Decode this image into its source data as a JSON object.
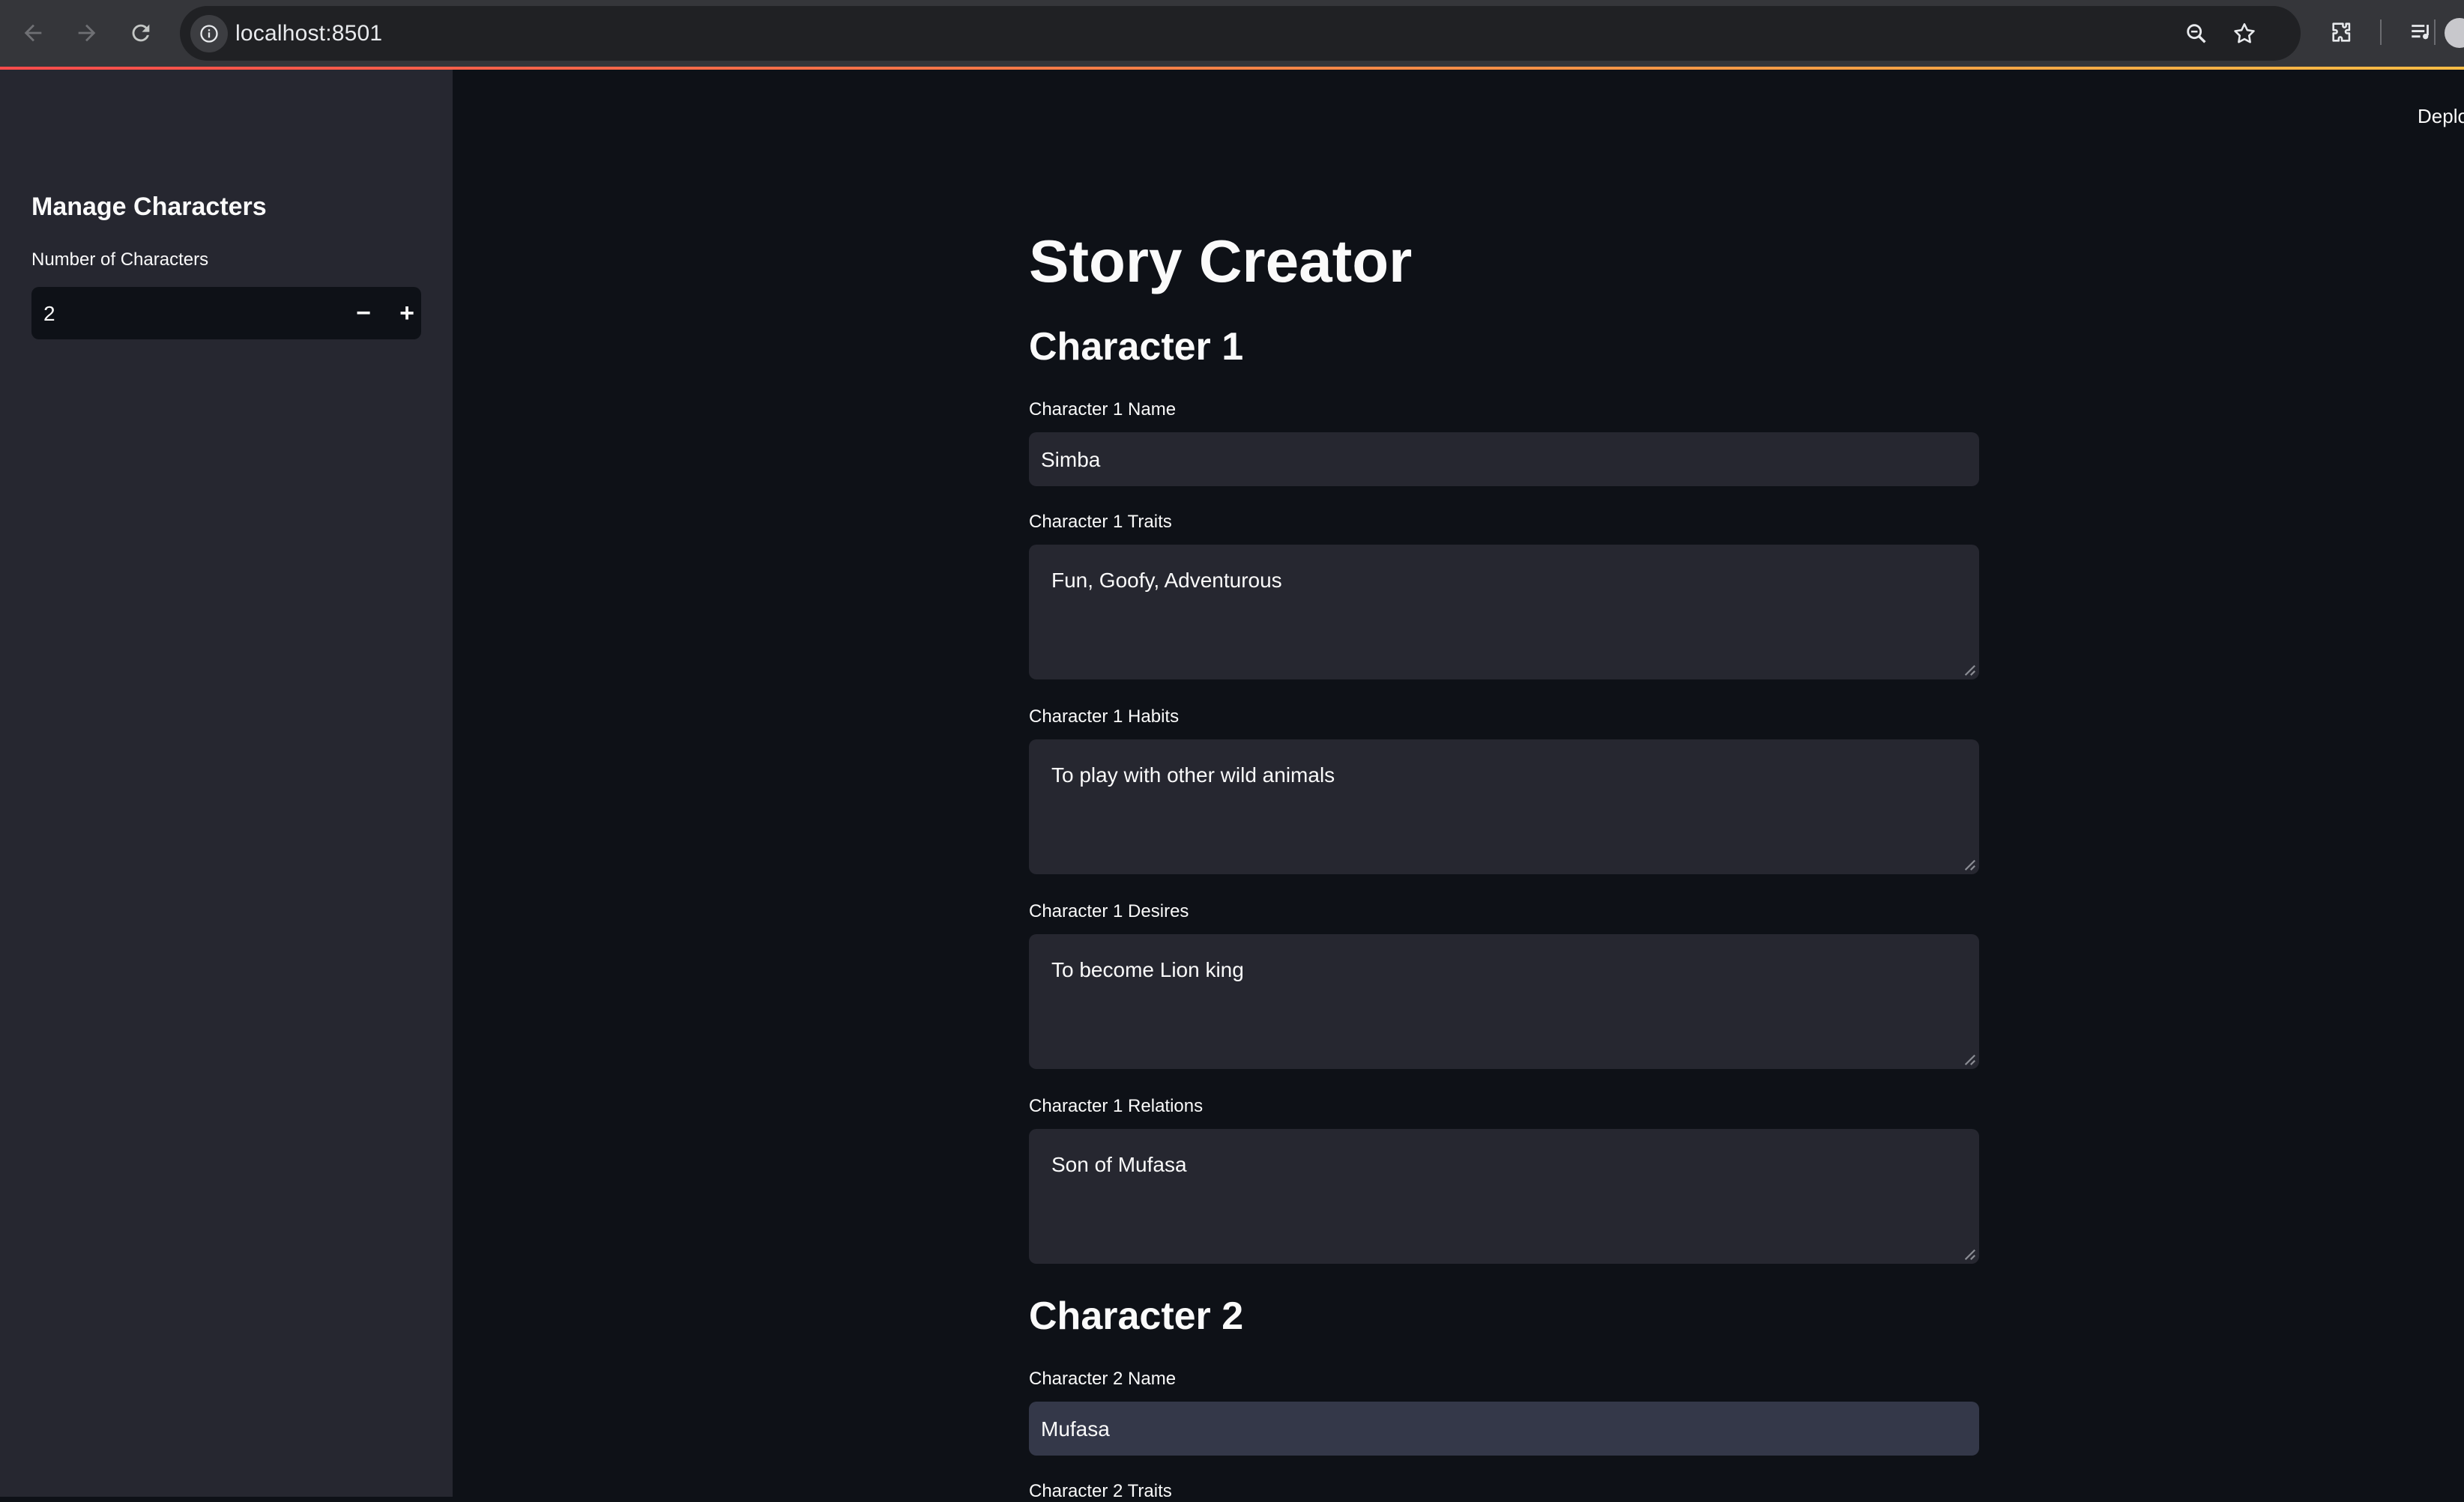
{
  "browser": {
    "url": "localhost:8501"
  },
  "header": {
    "deploy_label": "Deploy"
  },
  "sidebar": {
    "heading": "Manage Characters",
    "number_label": "Number of Characters",
    "number_value": "2",
    "decrement_label": "−",
    "increment_label": "+"
  },
  "main": {
    "title": "Story Creator",
    "characters": [
      {
        "heading": "Character 1",
        "name_label": "Character 1 Name",
        "name_value": "Simba",
        "traits_label": "Character 1 Traits",
        "traits_value": "Fun, Goofy, Adventurous",
        "habits_label": "Character 1 Habits",
        "habits_value": "To play with other wild animals",
        "desires_label": "Character 1 Desires",
        "desires_value": "To become Lion king",
        "relations_label": "Character 1 Relations",
        "relations_value": "Son of Mufasa"
      },
      {
        "heading": "Character 2",
        "name_label": "Character 2 Name",
        "name_value": "Mufasa",
        "traits_label": "Character 2 Traits"
      }
    ]
  },
  "colors": {
    "app_background": "#0e1117",
    "sidebar_background": "#262730",
    "input_background": "#262730",
    "focused_input_background": "#343849",
    "text": "#fafafa",
    "accent_gradient_start": "#ff4b4b",
    "accent_gradient_end": "#ffbd45"
  }
}
